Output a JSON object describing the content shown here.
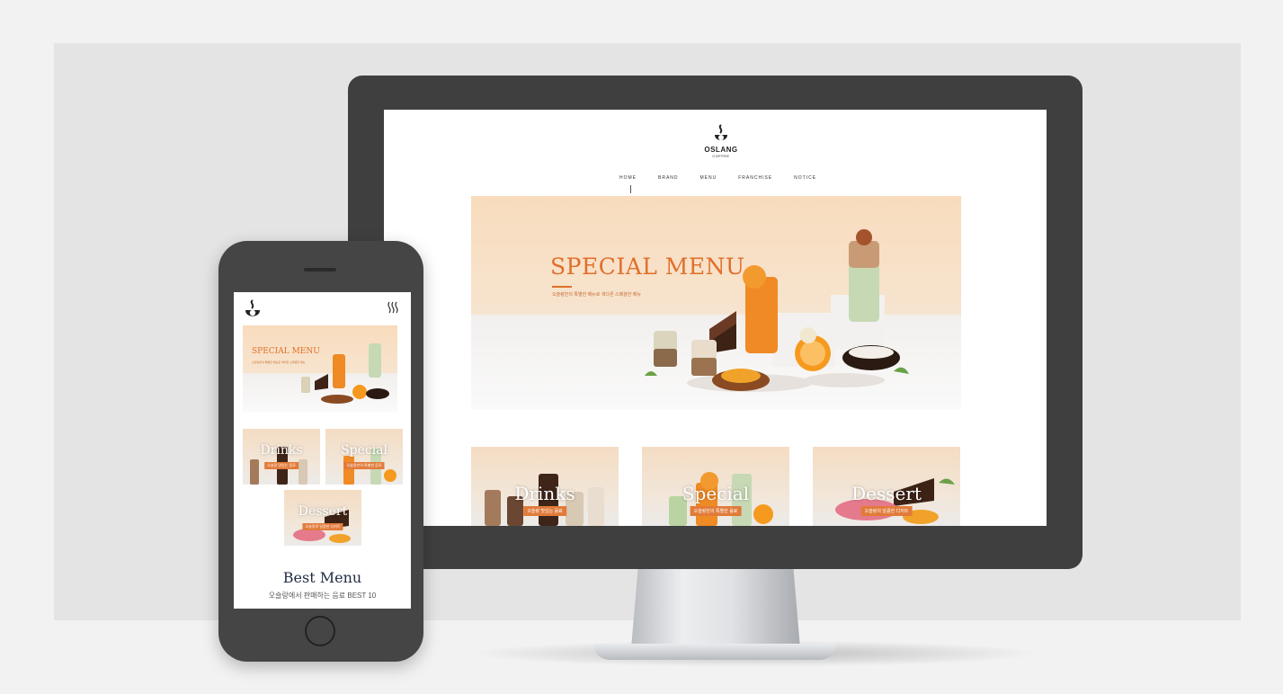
{
  "desktop": {
    "logo": {
      "name": "OSLANG",
      "sub": "COFFEE"
    },
    "nav": [
      {
        "label": "HOME"
      },
      {
        "label": "BRAND"
      },
      {
        "label": "MENU"
      },
      {
        "label": "FRANCHISE"
      },
      {
        "label": "NOTICE"
      }
    ],
    "hero": {
      "title": "SPECIAL MENU",
      "subtitle": "오슬랑만의 특별한 메뉴로 색다른 스페셜한 메뉴"
    },
    "cards": [
      {
        "title": "Drinks",
        "tag": "오슬랑 맛있는 음료"
      },
      {
        "title": "Special",
        "tag": "오슬랑만의 특별한 음료"
      },
      {
        "title": "Dessert",
        "tag": "오슬랑의 달콤한 디저트"
      }
    ]
  },
  "mobile": {
    "hero": {
      "title": "SPECIAL MENU",
      "subtitle": "오슬랑만의 특별한 메뉴로 색다른 스페셜한 메뉴"
    },
    "cards": [
      {
        "title": "Drinks",
        "tag": "오슬랑 맛있는 음료"
      },
      {
        "title": "Special",
        "tag": "오슬랑만의 특별한 음료"
      },
      {
        "title": "Dessert",
        "tag": "오슬랑의 달콤한 디저트"
      }
    ],
    "best": {
      "title": "Best Menu",
      "subtitle": "오슬랑에서 판매하는 음료 BEST 10"
    }
  },
  "colors": {
    "accent": "#e06f2a",
    "tag": "#e17b3a",
    "device": "#3f3f3f",
    "heading": "#1f2a44"
  },
  "icons": [
    "coffee-cup-logo-icon",
    "menu-icon"
  ]
}
